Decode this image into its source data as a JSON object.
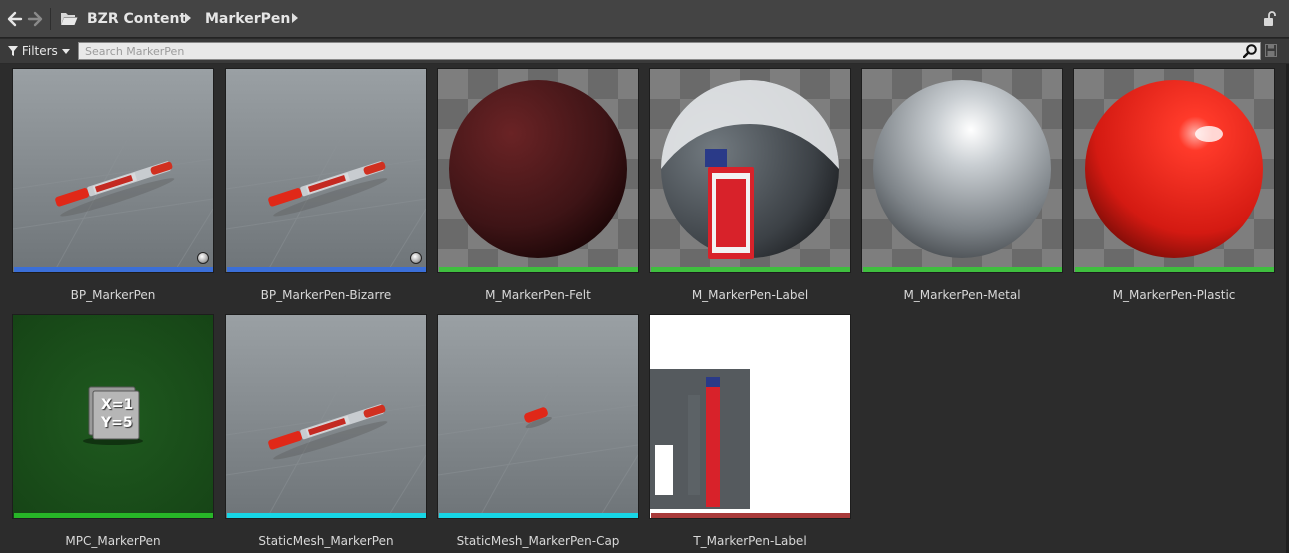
{
  "navigation": {
    "back_icon": "arrow-left-icon",
    "forward_icon": "arrow-right-icon",
    "folder_icon": "folder-open-icon",
    "breadcrumbs": [
      "BZR Content",
      "MarkerPen"
    ],
    "lock_icon": "lock-open-icon"
  },
  "filterbar": {
    "filters_label": "Filters",
    "search_placeholder": "Search MarkerPen",
    "search_value": "",
    "search_icon": "magnifier-icon",
    "save_icon": "save-icon"
  },
  "colors": {
    "blueprint": "#3b6fd8",
    "material": "#3fbf3f",
    "mpc": "#27b627",
    "static_mesh": "#17d6e6",
    "texture": "#a83a3a"
  },
  "assets": [
    {
      "name": "BP_MarkerPen",
      "type": "blueprint",
      "thumb": "pen",
      "badge": true
    },
    {
      "name": "BP_MarkerPen-Bizarre",
      "type": "blueprint",
      "thumb": "pen",
      "badge": true
    },
    {
      "name": "M_MarkerPen-Felt",
      "type": "material",
      "thumb": "sphere-felt"
    },
    {
      "name": "M_MarkerPen-Label",
      "type": "material",
      "thumb": "sphere-label"
    },
    {
      "name": "M_MarkerPen-Metal",
      "type": "material",
      "thumb": "sphere-metal"
    },
    {
      "name": "M_MarkerPen-Plastic",
      "type": "material",
      "thumb": "sphere-plastic"
    },
    {
      "name": "MPC_MarkerPen",
      "type": "mpc",
      "thumb": "mpc",
      "mpc_lines": [
        "X=1",
        "Y=5"
      ]
    },
    {
      "name": "StaticMesh_MarkerPen",
      "type": "static_mesh",
      "thumb": "pen-mesh"
    },
    {
      "name": "StaticMesh_MarkerPen-Cap",
      "type": "static_mesh",
      "thumb": "cap-mesh"
    },
    {
      "name": "T_MarkerPen-Label",
      "type": "texture",
      "thumb": "texture"
    }
  ]
}
